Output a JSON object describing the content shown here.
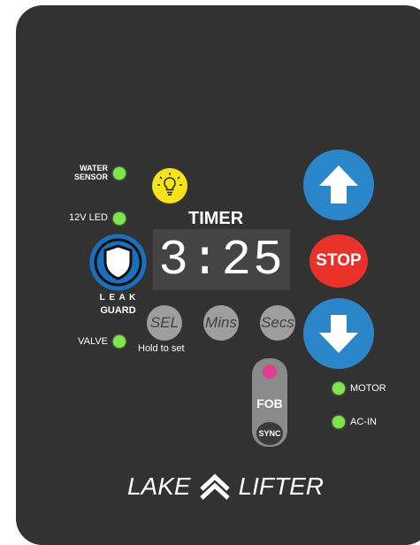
{
  "indicators": {
    "water_sensor": "WATER\nSENSOR",
    "led_12v": "12V LED",
    "valve": "VALVE",
    "motor": "MOTOR",
    "ac_in": "AC-IN"
  },
  "leak_guard": {
    "line1": "L E A K",
    "line2": "GUARD"
  },
  "timer": {
    "title": "TIMER",
    "display": "3:25"
  },
  "buttons": {
    "sel": "SEL",
    "mins": "Mins",
    "secs": "Secs",
    "hold_to_set": "Hold to set",
    "stop": "STOP",
    "fob": "FOB",
    "sync": "SYNC"
  },
  "brand": {
    "name_left": "LAKE",
    "name_right": "LIFTER"
  },
  "colors": {
    "panel": "#323232",
    "led_green": "#7ee54a",
    "arrow_blue": "#2a86c8",
    "stop_red": "#e8322a",
    "bulb_yellow": "#f7e31a",
    "fob_pink": "#e63a96",
    "button_gray": "#9e9e9e"
  },
  "icons": [
    "lightbulb-icon",
    "shield-icon",
    "arrow-up-icon",
    "arrow-down-icon",
    "chevron-up-logo-icon"
  ]
}
